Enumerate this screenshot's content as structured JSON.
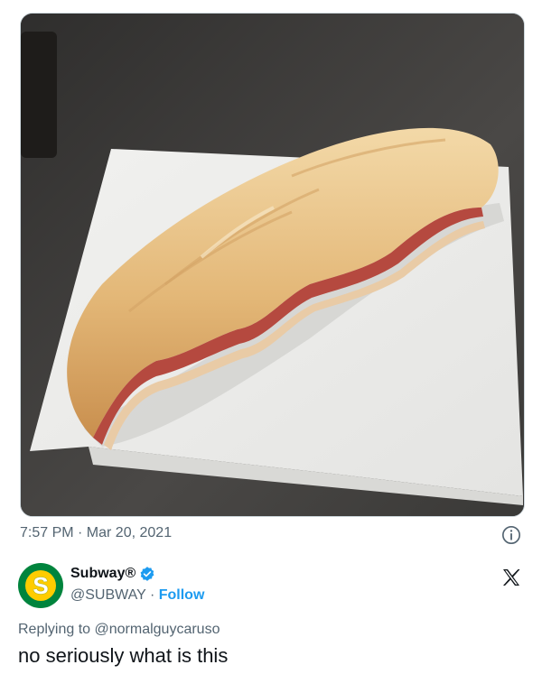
{
  "tweet": {
    "timestamp": "7:57 PM · Mar 20, 2021",
    "photo_alt": "Half-eaten sub sandwich on a white napkin"
  },
  "reply": {
    "display_name": "Subway®",
    "handle": "@SUBWAY",
    "separator": " · ",
    "follow_label": "Follow",
    "replying_prefix": "Replying to ",
    "replying_to": "@normalguycaruso",
    "text": "no seriously what is this"
  },
  "icons": {
    "info": "info-icon",
    "verified": "verified-badge-icon",
    "platform": "x-logo-icon",
    "avatar": "subway-logo-avatar"
  },
  "colors": {
    "link": "#1d9bf0",
    "muted": "#536471",
    "subway_green": "#00843d",
    "subway_yellow": "#ffcc00"
  }
}
